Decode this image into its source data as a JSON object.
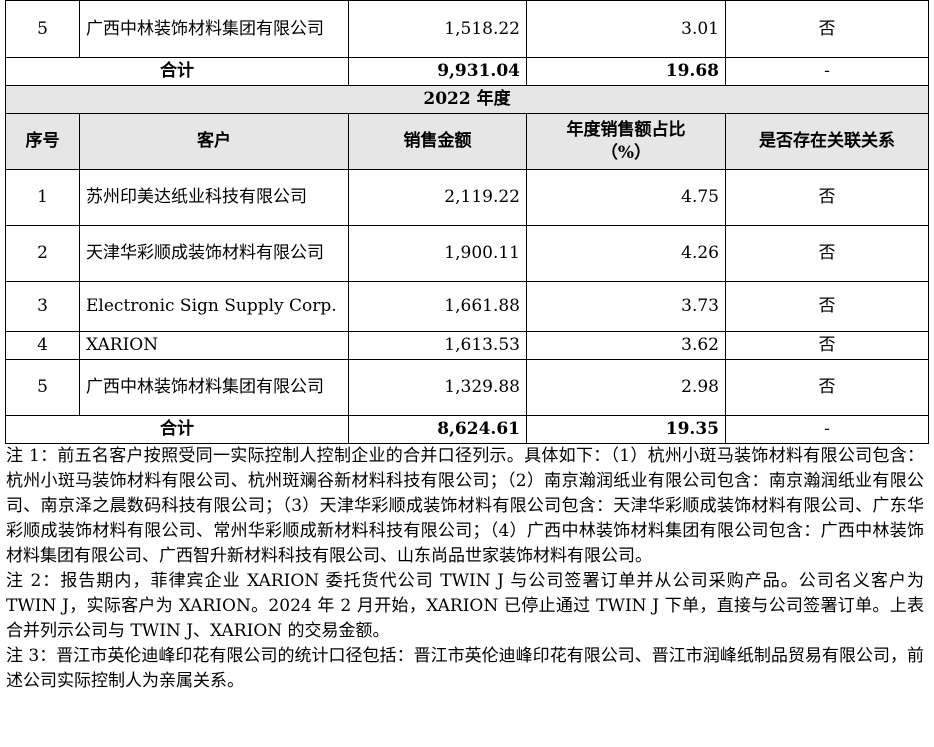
{
  "top_row": {
    "no": "5",
    "customer": "广西中林装饰材料集团有限公司",
    "amount": "1,518.22",
    "pct": "3.01",
    "related": "否"
  },
  "top_total": {
    "label": "合计",
    "amount": "9,931.04",
    "pct": "19.68",
    "related": "-"
  },
  "section_title": "2022 年度",
  "headers": {
    "no": "序号",
    "customer": "客户",
    "amount": "销售金额",
    "pct": "年度销售额占比（%）",
    "related": "是否存在关联关系"
  },
  "rows": [
    {
      "no": "1",
      "customer": "苏州印美达纸业科技有限公司",
      "amount": "2,119.22",
      "pct": "4.75",
      "related": "否"
    },
    {
      "no": "2",
      "customer": "天津华彩顺成装饰材料有限公司",
      "amount": "1,900.11",
      "pct": "4.26",
      "related": "否"
    },
    {
      "no": "3",
      "customer": "Electronic Sign Supply Corp.",
      "amount": "1,661.88",
      "pct": "3.73",
      "related": "否"
    },
    {
      "no": "4",
      "customer": "XARION",
      "amount": "1,613.53",
      "pct": "3.62",
      "related": "否"
    },
    {
      "no": "5",
      "customer": "广西中林装饰材料集团有限公司",
      "amount": "1,329.88",
      "pct": "2.98",
      "related": "否"
    }
  ],
  "total": {
    "label": "合计",
    "amount": "8,624.61",
    "pct": "19.35",
    "related": "-"
  },
  "notes": [
    "注 1：前五名客户按照受同一实际控制人控制企业的合并口径列示。具体如下：（1）杭州小斑马装饰材料有限公司包含：杭州小斑马装饰材料有限公司、杭州斑斓谷新材料科技有限公司；（2）南京瀚润纸业有限公司包含：南京瀚润纸业有限公司、南京泽之晨数码科技有限公司；（3）天津华彩顺成装饰材料有限公司包含：天津华彩顺成装饰材料有限公司、广东华彩顺成装饰材料有限公司、常州华彩顺成新材料科技有限公司；（4）广西中林装饰材料集团有限公司包含：广西中林装饰材料集团有限公司、广西智升新材料科技有限公司、山东尚品世家装饰材料有限公司。",
    "注 2：报告期内，菲律宾企业 XARION 委托货代公司 TWIN J 与公司签署订单并从公司采购产品。公司名义客户为 TWIN J，实际客户为 XARION。2024 年 2 月开始，XARION 已停止通过 TWIN J 下单，直接与公司签署订单。上表合并列示公司与 TWIN J、XARION 的交易金额。",
    "注 3：晋江市英伦迪峰印花有限公司的统计口径包括：晋江市英伦迪峰印花有限公司、晋江市润峰纸制品贸易有限公司，前述公司实际控制人为亲属关系。"
  ]
}
